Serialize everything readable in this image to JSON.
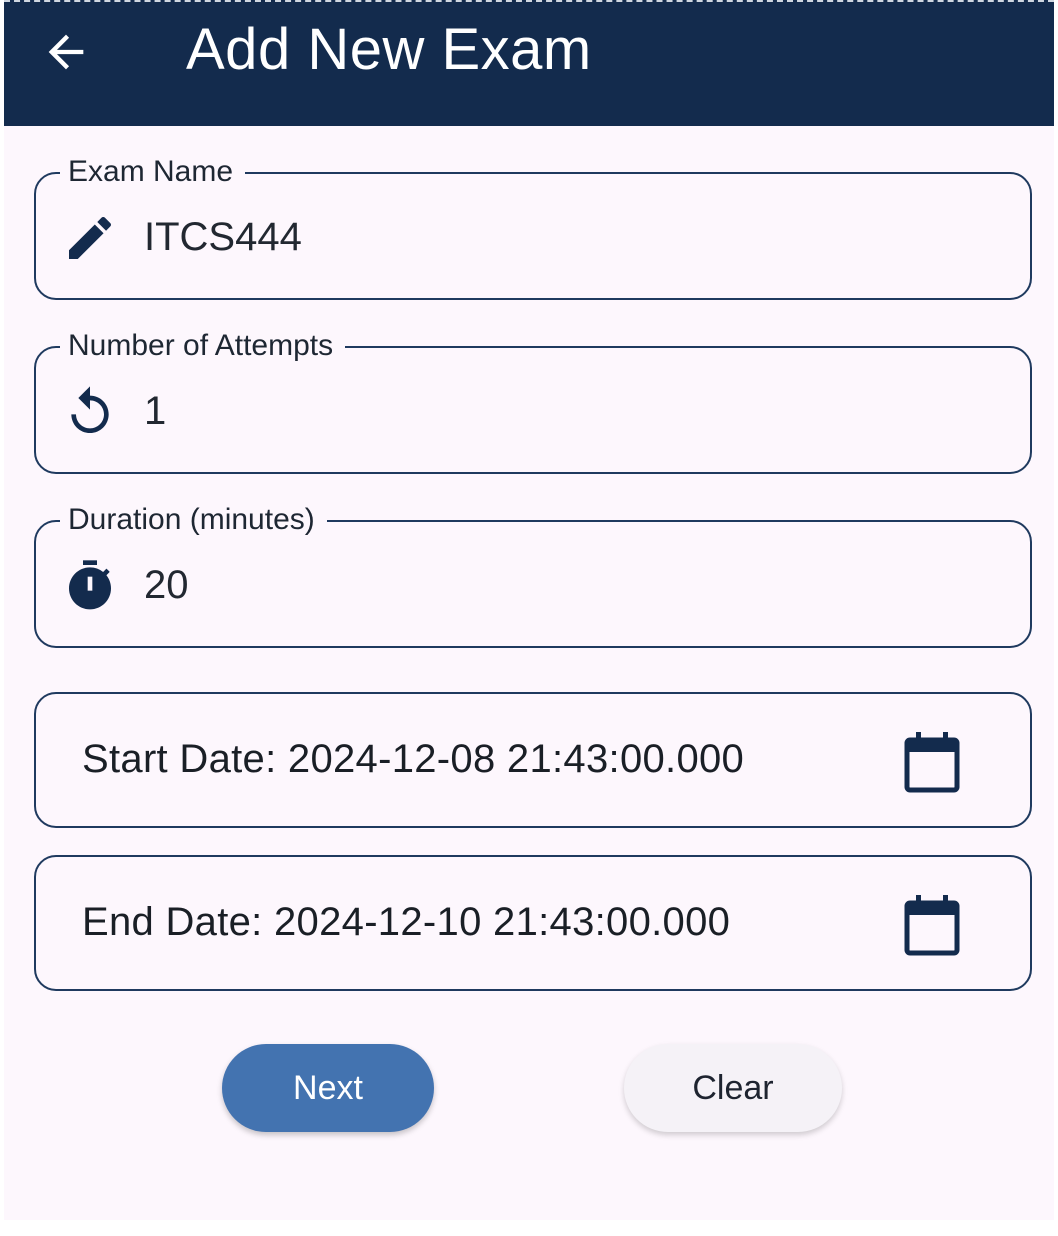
{
  "app_bar": {
    "title": "Add New Exam",
    "back_icon": "arrow-back-icon",
    "background": "#132b4d"
  },
  "form": {
    "exam_name": {
      "label": "Exam Name",
      "value": "ITCS444",
      "icon": "edit-pencil-icon"
    },
    "attempts": {
      "label": "Number of Attempts",
      "value": "1",
      "icon": "replay-icon"
    },
    "duration": {
      "label": "Duration (minutes)",
      "value": "20",
      "icon": "timer-icon"
    },
    "start_date": {
      "text": "Start Date: 2024-12-08 21:43:00.000",
      "icon": "calendar-icon"
    },
    "end_date": {
      "text": "End Date: 2024-12-10 21:43:00.000",
      "icon": "calendar-icon"
    }
  },
  "actions": {
    "next_label": "Next",
    "clear_label": "Clear"
  },
  "colors": {
    "accent": "#4373b0",
    "border": "#1f3a5f",
    "surface": "#fdf7fd"
  }
}
